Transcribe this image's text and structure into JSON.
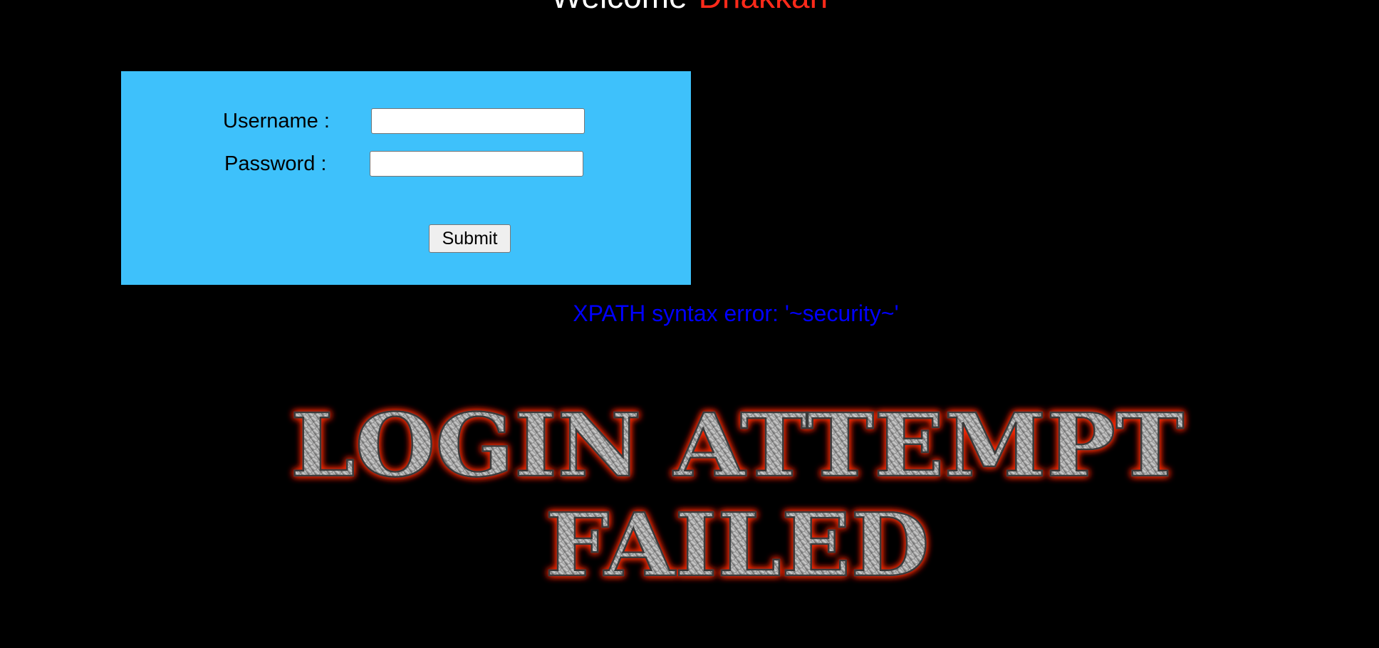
{
  "header": {
    "greeting": "Welcome",
    "username_display": "Dhakkan"
  },
  "login_form": {
    "username_label": "Username :",
    "password_label": "Password :",
    "username_value": "",
    "password_value": "",
    "submit_label": "Submit"
  },
  "error": {
    "message": "XPATH syntax error: '~security~'"
  },
  "banner": {
    "line1": "LOGIN ATTEMPT",
    "line2": "FAILED"
  },
  "colors": {
    "background": "#000000",
    "form_background": "#3ec1fb",
    "welcome_name": "#ff2a1a",
    "error_text": "#0000ff",
    "banner_glow": "#ff2a00"
  }
}
